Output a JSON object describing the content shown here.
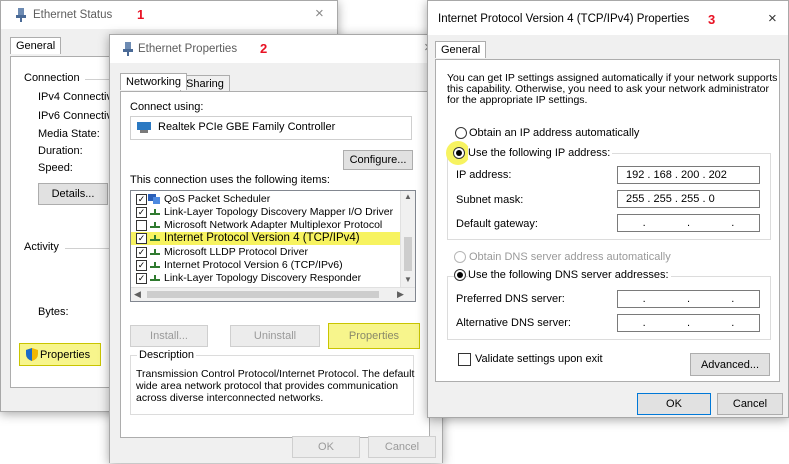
{
  "win1": {
    "title": "Ethernet Status",
    "step": "1",
    "close": "×",
    "tab_general": "General",
    "connection": "Connection",
    "rows": [
      "IPv4 Connectivit",
      "IPv6 Connectivit",
      "Media State:",
      "Duration:",
      "Speed:"
    ],
    "details_btn": "Details...",
    "activity": "Activity",
    "bytes": "Bytes:",
    "properties_btn": "Properties"
  },
  "win2": {
    "title": "Ethernet Properties",
    "step": "2",
    "close": "×",
    "tab_networking": "Networking",
    "tab_sharing": "Sharing",
    "connect_using": "Connect using:",
    "adapter": "Realtek PCIe GBE Family Controller",
    "configure_btn": "Configure...",
    "items_label": "This connection uses the following items:",
    "items": [
      {
        "label": "QoS Packet Scheduler",
        "checked": true
      },
      {
        "label": "Link-Layer Topology Discovery Mapper I/O Driver",
        "checked": true
      },
      {
        "label": "Microsoft Network Adapter Multiplexor Protocol",
        "checked": false
      },
      {
        "label": "Internet Protocol Version 4 (TCP/IPv4)",
        "checked": true
      },
      {
        "label": "Microsoft LLDP Protocol Driver",
        "checked": true
      },
      {
        "label": "Internet Protocol Version 6 (TCP/IPv6)",
        "checked": true
      },
      {
        "label": "Link-Layer Topology Discovery Responder",
        "checked": true
      }
    ],
    "install_btn": "Install...",
    "uninstall_btn": "Uninstall",
    "properties_btn": "Properties",
    "description_title": "Description",
    "description_line1": "Transmission Control Protocol/Internet Protocol. The default",
    "description_line2": "wide area network protocol that provides communication",
    "description_line3": "across diverse interconnected networks.",
    "ok_btn": "OK",
    "cancel_btn": "Cancel"
  },
  "win3": {
    "title": "Internet Protocol Version 4 (TCP/IPv4) Properties",
    "step": "3",
    "close": "×",
    "tab_general": "General",
    "intro_line1": "You can get IP settings assigned automatically if your network supports",
    "intro_line2": "this capability. Otherwise, you need to ask your network administrator",
    "intro_line3": "for the appropriate IP settings.",
    "obtain_ip_auto": "Obtain an IP address automatically",
    "use_following_ip": "Use the following IP address:",
    "ip_label": "IP address:",
    "ip_value": "192 . 168 . 200 . 202",
    "subnet_label": "Subnet mask:",
    "subnet_value": "255 . 255 . 255 . 0",
    "gateway_label": "Default gateway:",
    "obtain_dns_auto": "Obtain DNS server address automatically",
    "use_following_dns": "Use the following DNS server addresses:",
    "preferred_dns_label": "Preferred DNS server:",
    "alternate_dns_label": "Alternative DNS server:",
    "validate_label": "Validate settings upon exit",
    "advanced_btn": "Advanced...",
    "ok_btn": "OK",
    "cancel_btn": "Cancel"
  },
  "colors": {
    "highlight": "#f7f58c",
    "step_number": "#e81123",
    "selection": "#f7f360"
  }
}
